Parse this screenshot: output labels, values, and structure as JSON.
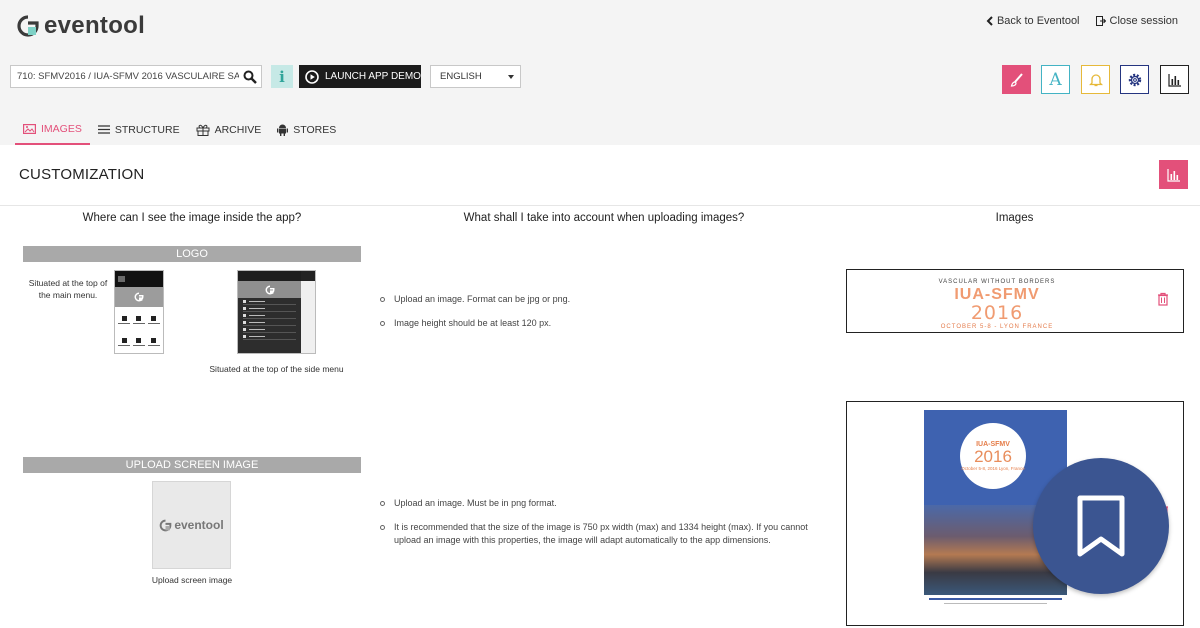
{
  "brand": {
    "name": "eventool"
  },
  "top_links": {
    "back": "Back to Eventool",
    "close": "Close session"
  },
  "toolbar": {
    "event_value": "710: SFMV2016 / IUA-SFMV 2016 VASCULAIRE SA...",
    "info_label": "i",
    "demo_label": "LAUNCH APP DEMO",
    "language": "ENGLISH",
    "font_tool_label": "A"
  },
  "tabs": [
    {
      "label": "IMAGES",
      "active": true
    },
    {
      "label": "STRUCTURE",
      "active": false
    },
    {
      "label": "ARCHIVE",
      "active": false
    },
    {
      "label": "STORES",
      "active": false
    }
  ],
  "section": {
    "title": "CUSTOMIZATION"
  },
  "columns": {
    "where": "Where can I see the image inside the app?",
    "what": "What shall I take into account when uploading images?",
    "images": "Images"
  },
  "logo_section": {
    "title": "LOGO",
    "note_main": "Situated at the top of the main menu.",
    "note_side": "Situated at the top of the side menu",
    "bullets": [
      "Upload an image. Format can be jpg or png.",
      "Image height should be at least 120 px."
    ],
    "banner": {
      "small": "VASCULAR WITHOUT BORDERS",
      "big": "IUA-SFMV",
      "year": "2016",
      "sub": "OCTOBER 5-8 - LYON FRANCE"
    }
  },
  "upload_section": {
    "title": "UPLOAD SCREEN IMAGE",
    "caption": "Upload screen image",
    "preview_brand": "eventool",
    "bullets": [
      "Upload an image. Must be in png format.",
      "It is recommended that the size of the image is 750 px width (max) and 1334 height (max). If you cannot upload an image with this properties, the image will adapt automatically to the app dimensions."
    ],
    "poster": {
      "t1": "IUA-SFMV",
      "t2": "2016",
      "t3": "October 5-8, 2016 Lyon, France"
    }
  },
  "colors": {
    "accent": "#e3507a",
    "teal": "#43b3c4",
    "gold": "#e6b93a",
    "navy": "#253580",
    "bookmark": "#3b5591"
  }
}
